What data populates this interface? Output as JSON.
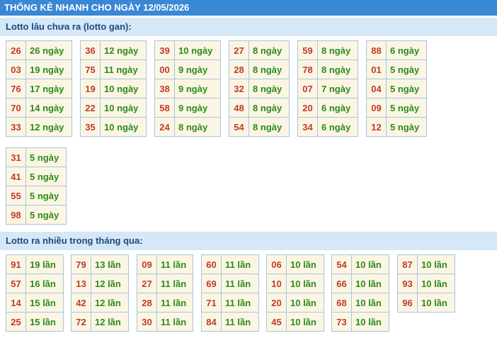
{
  "header": {
    "title": "THỐNG KÊ NHANH CHO NGÀY 12/05/2026"
  },
  "gan": {
    "title": "Lotto lâu chưa ra (lotto gan):",
    "groups": [
      [
        [
          "26",
          "26 ngày"
        ],
        [
          "03",
          "19 ngày"
        ],
        [
          "76",
          "17 ngày"
        ],
        [
          "70",
          "14 ngày"
        ],
        [
          "33",
          "12 ngày"
        ]
      ],
      [
        [
          "36",
          "12 ngày"
        ],
        [
          "75",
          "11 ngày"
        ],
        [
          "19",
          "10 ngày"
        ],
        [
          "22",
          "10 ngày"
        ],
        [
          "35",
          "10 ngày"
        ]
      ],
      [
        [
          "39",
          "10 ngày"
        ],
        [
          "00",
          "9 ngày"
        ],
        [
          "38",
          "9 ngày"
        ],
        [
          "58",
          "9 ngày"
        ],
        [
          "24",
          "8 ngày"
        ]
      ],
      [
        [
          "27",
          "8 ngày"
        ],
        [
          "28",
          "8 ngày"
        ],
        [
          "32",
          "8 ngày"
        ],
        [
          "48",
          "8 ngày"
        ],
        [
          "54",
          "8 ngày"
        ]
      ],
      [
        [
          "59",
          "8 ngày"
        ],
        [
          "78",
          "8 ngày"
        ],
        [
          "07",
          "7 ngày"
        ],
        [
          "20",
          "6 ngày"
        ],
        [
          "34",
          "6 ngày"
        ]
      ],
      [
        [
          "88",
          "6 ngày"
        ],
        [
          "01",
          "5 ngày"
        ],
        [
          "04",
          "5 ngày"
        ],
        [
          "09",
          "5 ngày"
        ],
        [
          "12",
          "5 ngày"
        ]
      ],
      [
        [
          "31",
          "5 ngày"
        ],
        [
          "41",
          "5 ngày"
        ],
        [
          "55",
          "5 ngày"
        ],
        [
          "98",
          "5 ngày"
        ]
      ]
    ]
  },
  "nhieu": {
    "title": "Lotto ra nhiều trong tháng qua:",
    "groups": [
      [
        [
          "91",
          "19 lần"
        ],
        [
          "57",
          "16 lần"
        ],
        [
          "14",
          "15 lần"
        ],
        [
          "25",
          "15 lần"
        ]
      ],
      [
        [
          "79",
          "13 lần"
        ],
        [
          "13",
          "12 lần"
        ],
        [
          "42",
          "12 lần"
        ],
        [
          "72",
          "12 lần"
        ]
      ],
      [
        [
          "09",
          "11 lần"
        ],
        [
          "27",
          "11 lần"
        ],
        [
          "28",
          "11 lần"
        ],
        [
          "30",
          "11 lần"
        ]
      ],
      [
        [
          "60",
          "11 lần"
        ],
        [
          "69",
          "11 lần"
        ],
        [
          "71",
          "11 lần"
        ],
        [
          "84",
          "11 lần"
        ]
      ],
      [
        [
          "06",
          "10 lần"
        ],
        [
          "10",
          "10 lần"
        ],
        [
          "20",
          "10 lần"
        ],
        [
          "45",
          "10 lần"
        ]
      ],
      [
        [
          "54",
          "10 lần"
        ],
        [
          "66",
          "10 lần"
        ],
        [
          "68",
          "10 lần"
        ],
        [
          "73",
          "10 lần"
        ]
      ],
      [
        [
          "87",
          "10 lần"
        ],
        [
          "93",
          "10 lần"
        ],
        [
          "96",
          "10 lần"
        ]
      ]
    ]
  }
}
